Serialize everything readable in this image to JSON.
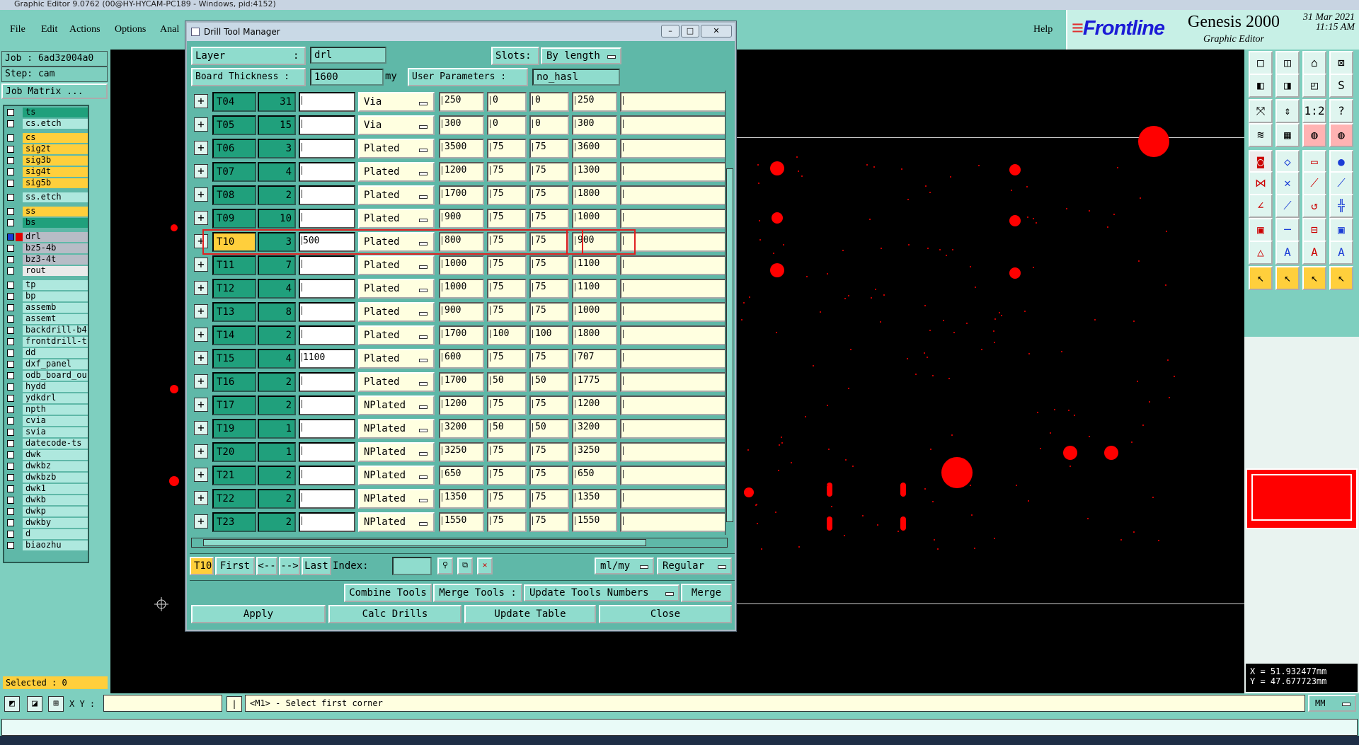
{
  "app": {
    "title": "Graphic Editor 9.0762 (00@HY-HYCAM-PC189 - Windows, pid:4152)"
  },
  "menu": {
    "file": "File",
    "edit": "Edit",
    "actions": "Actions",
    "options": "Options",
    "analysis": "Anal",
    "help": "Help"
  },
  "brand": {
    "logo": "Frontline",
    "product": "Genesis 2000",
    "subtitle": "Graphic Editor",
    "date": "31 Mar 2021",
    "time": "11:15 AM"
  },
  "job": {
    "job_label": "Job : 6ad3z004a0",
    "step_label": "Step: cam",
    "matrix_button": "Job Matrix ..."
  },
  "layers": [
    {
      "name": "ts",
      "color": "teal"
    },
    {
      "name": "cs.etch",
      "color": "light"
    },
    {
      "name": "cs",
      "color": "yellow"
    },
    {
      "name": "sig2t",
      "color": "yellow"
    },
    {
      "name": "sig3b",
      "color": "yellow"
    },
    {
      "name": "sig4t",
      "color": "yellow"
    },
    {
      "name": "sig5b",
      "color": "yellow"
    },
    {
      "name": "ss.etch",
      "color": "light"
    },
    {
      "name": "ss",
      "color": "yellow"
    },
    {
      "name": "bs",
      "color": "teal"
    },
    {
      "name": "drl",
      "color": "selected"
    },
    {
      "name": "bz5-4b",
      "color": "gray"
    },
    {
      "name": "bz3-4t",
      "color": "gray"
    },
    {
      "name": "rout",
      "color": "white"
    },
    {
      "name": "tp",
      "color": "light"
    },
    {
      "name": "bp",
      "color": "light"
    },
    {
      "name": "assemb",
      "color": "light"
    },
    {
      "name": "assemt",
      "color": "light"
    },
    {
      "name": "backdrill-b4",
      "color": "light"
    },
    {
      "name": "frontdrill-t",
      "color": "light"
    },
    {
      "name": "dd",
      "color": "light"
    },
    {
      "name": "dxf_panel",
      "color": "light"
    },
    {
      "name": "odb_board_ou",
      "color": "light"
    },
    {
      "name": "hydd",
      "color": "light"
    },
    {
      "name": "ydkdrl",
      "color": "light"
    },
    {
      "name": "npth",
      "color": "light"
    },
    {
      "name": "cvia",
      "color": "light"
    },
    {
      "name": "svia",
      "color": "light"
    },
    {
      "name": "datecode-ts",
      "color": "light"
    },
    {
      "name": "dwk",
      "color": "light"
    },
    {
      "name": "dwkbz",
      "color": "light"
    },
    {
      "name": "dwkbzb",
      "color": "light"
    },
    {
      "name": "dwk1",
      "color": "light"
    },
    {
      "name": "dwkb",
      "color": "light"
    },
    {
      "name": "dwkp",
      "color": "light"
    },
    {
      "name": "dwkby",
      "color": "light"
    },
    {
      "name": "d",
      "color": "light"
    },
    {
      "name": "biaozhu",
      "color": "light"
    }
  ],
  "selected_count": "Selected : 0",
  "coords": {
    "x": "X = 51.932477mm",
    "y": "Y = 47.677723mm"
  },
  "bottom": {
    "xy_label": "X Y :",
    "xy_value": "",
    "message": "<M1> - Select first corner",
    "units": "MM"
  },
  "dialog": {
    "title": "Drill Tool Manager",
    "layer_label": "Layer",
    "layer_colon": ":",
    "layer_value": "drl",
    "slots_label": "Slots:",
    "slots_value": "By length",
    "thickness_label": "Board Thickness :",
    "thickness_value": "1600",
    "thickness_unit": "my",
    "user_params_label": "User Parameters :",
    "user_params_value": "no_hasl",
    "current_tool": "T10",
    "nav": {
      "first": "First",
      "prev": "<--",
      "next": "-->",
      "last": "Last",
      "index_label": "Index:",
      "units": "ml/my",
      "mode": "Regular"
    },
    "actions": {
      "combine": "Combine Tools",
      "merge_tools": "Merge Tools :",
      "update_numbers": "Update Tools Numbers",
      "merge": "Merge",
      "apply": "Apply",
      "calc": "Calc Drills",
      "update_table": "Update Table",
      "close": "Close"
    },
    "tools": [
      {
        "name": "T04",
        "count": "31",
        "finish": "",
        "type": "Via",
        "drill": "250",
        "tol_plus": "0",
        "tol_minus": "0",
        "size": "250"
      },
      {
        "name": "T05",
        "count": "15",
        "finish": "",
        "type": "Via",
        "drill": "300",
        "tol_plus": "0",
        "tol_minus": "0",
        "size": "300"
      },
      {
        "name": "T06",
        "count": "3",
        "finish": "",
        "type": "Plated",
        "drill": "3500",
        "tol_plus": "75",
        "tol_minus": "75",
        "size": "3600"
      },
      {
        "name": "T07",
        "count": "4",
        "finish": "",
        "type": "Plated",
        "drill": "1200",
        "tol_plus": "75",
        "tol_minus": "75",
        "size": "1300"
      },
      {
        "name": "T08",
        "count": "2",
        "finish": "",
        "type": "Plated",
        "drill": "1700",
        "tol_plus": "75",
        "tol_minus": "75",
        "size": "1800"
      },
      {
        "name": "T09",
        "count": "10",
        "finish": "",
        "type": "Plated",
        "drill": "900",
        "tol_plus": "75",
        "tol_minus": "75",
        "size": "1000"
      },
      {
        "name": "T10",
        "count": "3",
        "finish": "500",
        "type": "Plated",
        "drill": "800",
        "tol_plus": "75",
        "tol_minus": "75",
        "size": "900"
      },
      {
        "name": "T11",
        "count": "7",
        "finish": "",
        "type": "Plated",
        "drill": "1000",
        "tol_plus": "75",
        "tol_minus": "75",
        "size": "1100"
      },
      {
        "name": "T12",
        "count": "4",
        "finish": "",
        "type": "Plated",
        "drill": "1000",
        "tol_plus": "75",
        "tol_minus": "75",
        "size": "1100"
      },
      {
        "name": "T13",
        "count": "8",
        "finish": "",
        "type": "Plated",
        "drill": "900",
        "tol_plus": "75",
        "tol_minus": "75",
        "size": "1000"
      },
      {
        "name": "T14",
        "count": "2",
        "finish": "",
        "type": "Plated",
        "drill": "1700",
        "tol_plus": "100",
        "tol_minus": "100",
        "size": "1800"
      },
      {
        "name": "T15",
        "count": "4",
        "finish": "1100",
        "type": "Plated",
        "drill": "600",
        "tol_plus": "75",
        "tol_minus": "75",
        "size": "707"
      },
      {
        "name": "T16",
        "count": "2",
        "finish": "",
        "type": "Plated",
        "drill": "1700",
        "tol_plus": "50",
        "tol_minus": "50",
        "size": "1775"
      },
      {
        "name": "T17",
        "count": "2",
        "finish": "",
        "type": "NPlated",
        "drill": "1200",
        "tol_plus": "75",
        "tol_minus": "75",
        "size": "1200"
      },
      {
        "name": "T19",
        "count": "1",
        "finish": "",
        "type": "NPlated",
        "drill": "3200",
        "tol_plus": "50",
        "tol_minus": "50",
        "size": "3200"
      },
      {
        "name": "T20",
        "count": "1",
        "finish": "",
        "type": "NPlated",
        "drill": "3250",
        "tol_plus": "75",
        "tol_minus": "75",
        "size": "3250"
      },
      {
        "name": "T21",
        "count": "2",
        "finish": "",
        "type": "NPlated",
        "drill": "650",
        "tol_plus": "75",
        "tol_minus": "75",
        "size": "650"
      },
      {
        "name": "T22",
        "count": "2",
        "finish": "",
        "type": "NPlated",
        "drill": "1350",
        "tol_plus": "75",
        "tol_minus": "75",
        "size": "1350"
      },
      {
        "name": "T23",
        "count": "2",
        "finish": "",
        "type": "NPlated",
        "drill": "1550",
        "tol_plus": "75",
        "tol_minus": "75",
        "size": "1550"
      }
    ]
  },
  "colors": {
    "panel": "#7ecfbf",
    "dialog": "#5fb8a8",
    "pad": "#ff0000",
    "active": "#ffcf3c",
    "highlight": "#e02020"
  }
}
